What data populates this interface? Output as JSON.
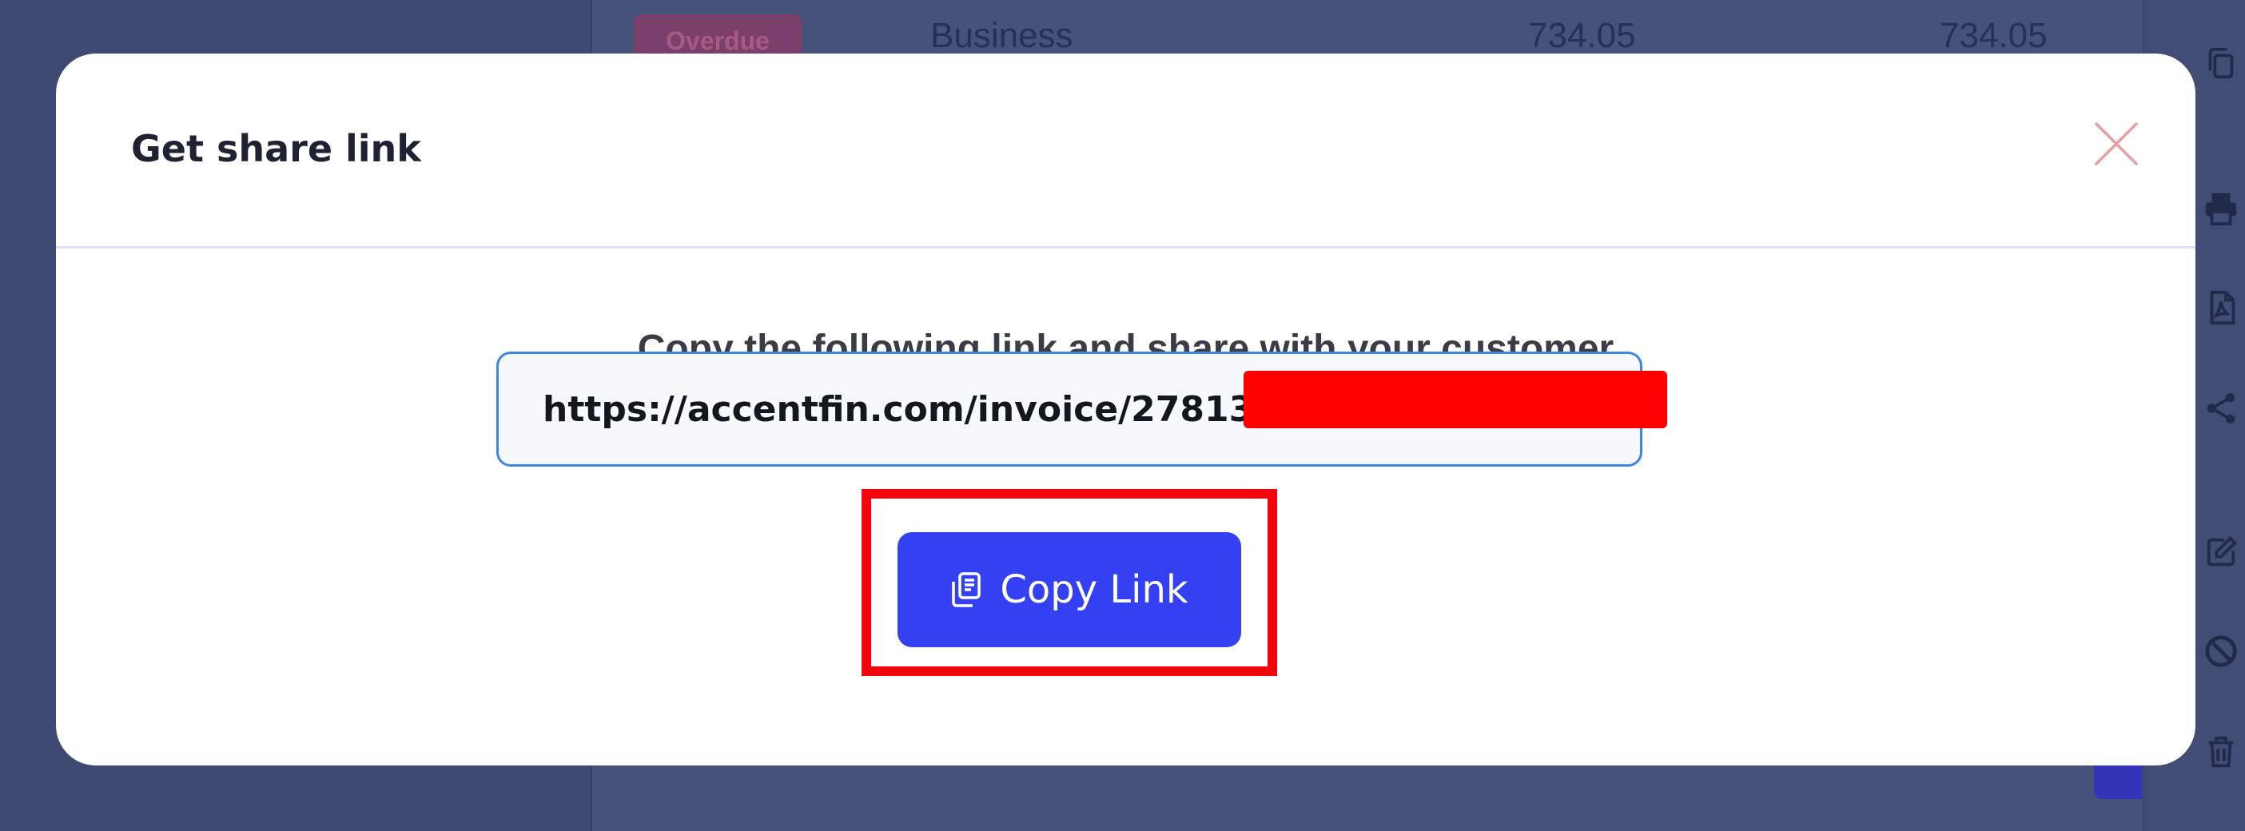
{
  "background": {
    "row": {
      "status_badge": "Overdue",
      "category": "Business",
      "amount": "734.05",
      "total": "734.05"
    },
    "side_icons": [
      "copy-icon",
      "print-icon",
      "pdf-icon",
      "share-icon",
      "edit-icon",
      "block-icon",
      "trash-icon"
    ]
  },
  "modal": {
    "title": "Get share link",
    "close_icon": "close-icon",
    "instruction": "Copy the following link and share with your customer",
    "link_value": "https://accentfin.com/invoice/27813",
    "copy_button_label": "Copy Link",
    "copy_button_icon": "copy-icon"
  },
  "colors": {
    "accent": "#3440f1",
    "close": "#e8a0a0",
    "input_border": "#3f86de",
    "highlight": "#f2060e",
    "redaction": "#ff0000"
  }
}
